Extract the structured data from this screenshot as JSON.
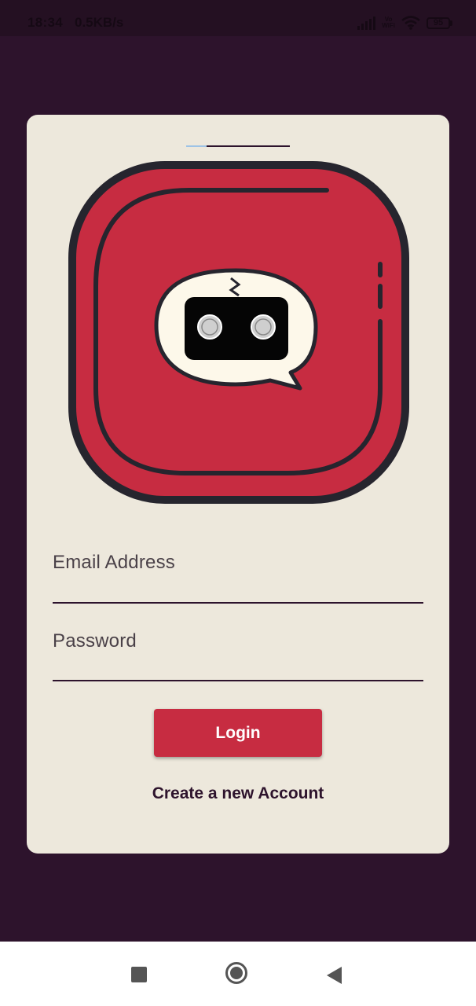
{
  "status_bar": {
    "time": "18:34",
    "speed": "0.5KB/s",
    "network_label": "Vo WiFi",
    "battery": "95"
  },
  "icons": {
    "signal": "signal-icon",
    "wifi": "wifi-icon",
    "battery": "battery-icon",
    "logo": "chat-robot-logo-icon"
  },
  "login_form": {
    "email_placeholder": "Email Address",
    "password_placeholder": "Password",
    "login_label": "Login",
    "create_account_label": "Create a new Account"
  },
  "nav_bar": {
    "recent": "recent-apps-icon",
    "home": "home-icon",
    "back": "back-icon"
  },
  "colors": {
    "background": "#2d132c",
    "card": "#ede8dc",
    "accent": "#c72c41",
    "logo_bubble": "#fdf8ea",
    "dark_stroke": "#26252e"
  }
}
